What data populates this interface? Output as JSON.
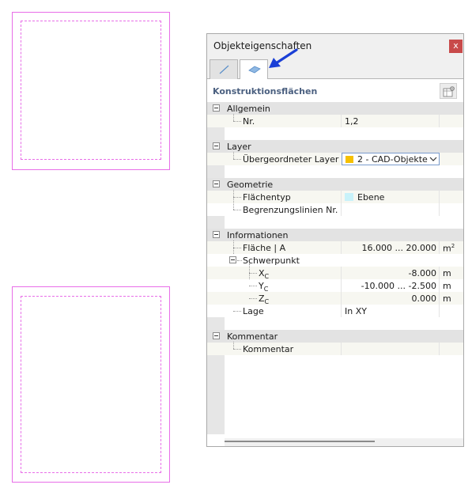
{
  "panel": {
    "title": "Objekteigenschaften",
    "close_label": "x",
    "tabs": [
      {
        "icon": "line-icon",
        "active": false
      },
      {
        "icon": "surface-icon",
        "active": true
      }
    ],
    "section_title": "Konstruktionsflächen"
  },
  "groups": {
    "allgemein": {
      "label": "Allgemein",
      "nr_label": "Nr.",
      "nr_value": "1,2"
    },
    "layer": {
      "label": "Layer",
      "parent_label": "Übergeordneter Layer",
      "parent_value": "2 - CAD-Objekte",
      "swatch_color": "#f5c000"
    },
    "geometrie": {
      "label": "Geometrie",
      "type_label": "Flächentyp",
      "type_value": "Ebene",
      "type_color": "#c8f2fa",
      "boundary_label": "Begrenzungslinien Nr.",
      "boundary_value": ""
    },
    "informationen": {
      "label": "Informationen",
      "area_label": "Fläche | A",
      "area_value": "16.000 ... 20.000",
      "area_unit": "m",
      "area_unit_sup": "2",
      "centroid_label": "Schwerpunkt",
      "xc_label": "X",
      "xc_sub": "C",
      "xc_value": "-8.000",
      "xc_unit": "m",
      "yc_label": "Y",
      "yc_sub": "C",
      "yc_value": "-10.000 ... -2.500",
      "yc_unit": "m",
      "zc_label": "Z",
      "zc_sub": "C",
      "zc_value": "0.000",
      "zc_unit": "m",
      "position_label": "Lage",
      "position_value": "In XY"
    },
    "kommentar": {
      "label": "Kommentar",
      "comment_label": "Kommentar",
      "comment_value": ""
    }
  },
  "colors": {
    "cad_outline": "#e86ee8",
    "accent_arrow": "#1a3fd6",
    "close_button": "#c84a4a"
  }
}
